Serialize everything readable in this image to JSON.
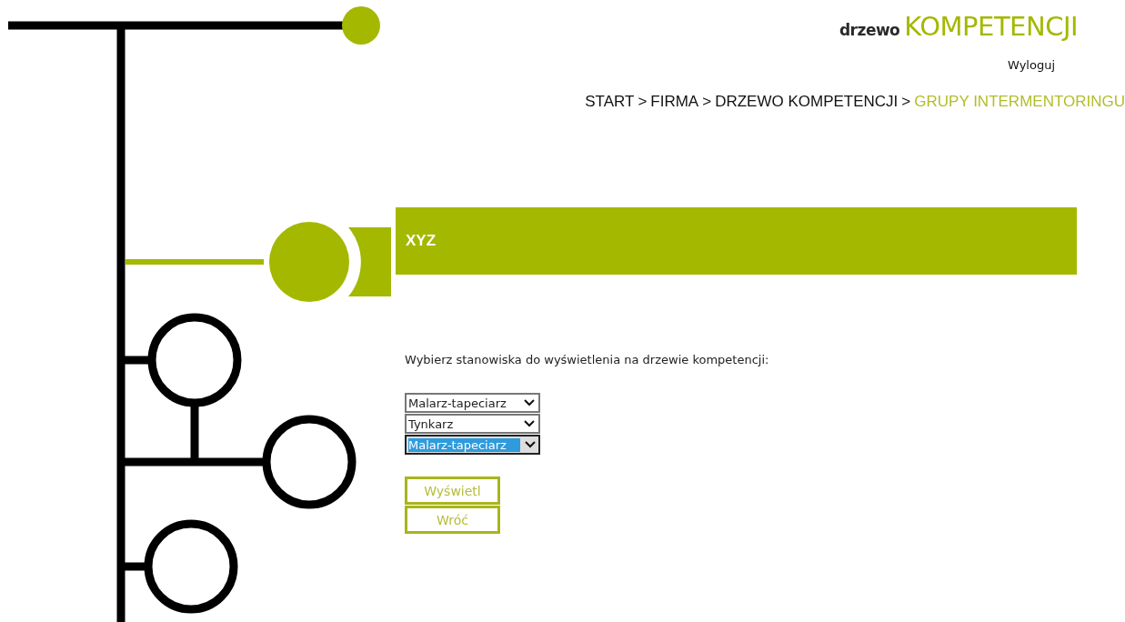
{
  "logo": {
    "prefix": "drzewo",
    "title": "KOMPETENCJI"
  },
  "logout": "Wyloguj",
  "breadcrumb": [
    {
      "kind": "link",
      "text": "START",
      "current": false
    },
    {
      "kind": "separator",
      "text": ">",
      "current": false
    },
    {
      "kind": "link",
      "text": "FIRMA",
      "current": false
    },
    {
      "kind": "separator",
      "text": ">",
      "current": false
    },
    {
      "kind": "link",
      "text": "DRZEWO KOMPETENCJI",
      "current": false
    },
    {
      "kind": "separator",
      "text": ">",
      "current": false
    },
    {
      "kind": "link",
      "text": "GRUPY INTERMENTORINGU",
      "current": true
    }
  ],
  "banner": {
    "title": "XYZ"
  },
  "prompt": "Wybierz stanowiska do wyświetlenia na drzewie kompetencji:",
  "selects": [
    {
      "value": "Malarz-tapeciarz",
      "focused": false
    },
    {
      "value": "Tynkarz",
      "focused": false
    },
    {
      "value": "Malarz-tapeciarz",
      "focused": true
    }
  ],
  "buttons": [
    "Wyświetl",
    "Wróć"
  ]
}
